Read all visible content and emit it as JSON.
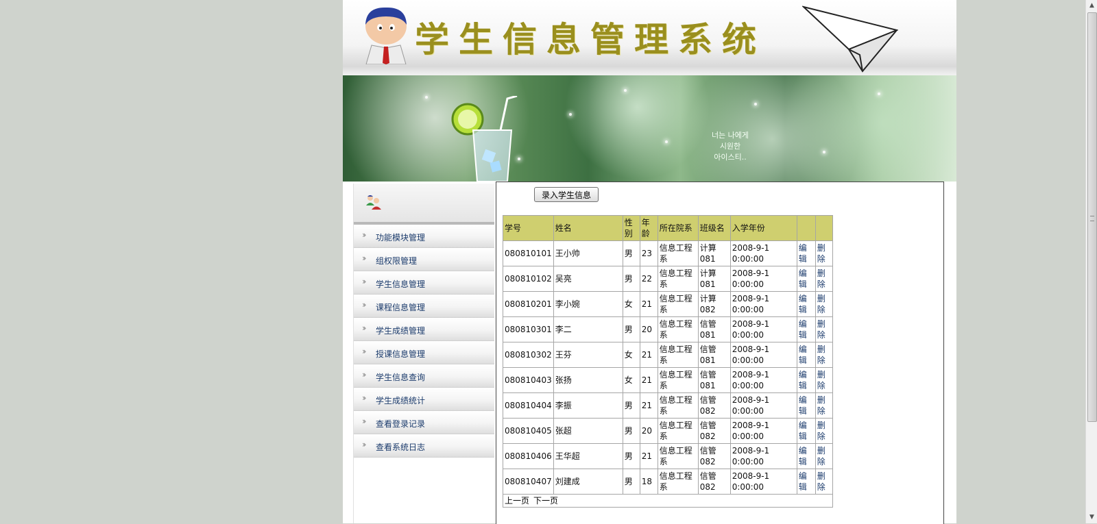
{
  "header": {
    "title": "学生信息管理系统"
  },
  "banner": {
    "caption_lines": [
      "너는 나에게",
      "시원한",
      "아이스티.."
    ]
  },
  "sidebar": {
    "items": [
      {
        "label": "功能模块管理"
      },
      {
        "label": "组权限管理"
      },
      {
        "label": "学生信息管理"
      },
      {
        "label": "课程信息管理"
      },
      {
        "label": "学生成绩管理"
      },
      {
        "label": "授课信息管理"
      },
      {
        "label": "学生信息查询"
      },
      {
        "label": "学生成绩统计"
      },
      {
        "label": "查看登录记录"
      },
      {
        "label": "查看系统日志"
      }
    ]
  },
  "main": {
    "add_button": "录入学生信息",
    "table": {
      "headers": [
        "学号",
        "姓名",
        "性别",
        "年龄",
        "所在院系",
        "班级名",
        "入学年份",
        "",
        ""
      ],
      "edit_label": "编辑",
      "delete_label": "删除",
      "rows": [
        [
          "080810101",
          "王小帅",
          "男",
          "23",
          "信息工程系",
          "计算081",
          "2008-9-1 0:00:00"
        ],
        [
          "080810102",
          "吴亮",
          "男",
          "22",
          "信息工程系",
          "计算081",
          "2008-9-1 0:00:00"
        ],
        [
          "080810201",
          "李小婉",
          "女",
          "21",
          "信息工程系",
          "计算082",
          "2008-9-1 0:00:00"
        ],
        [
          "080810301",
          "李二",
          "男",
          "20",
          "信息工程系",
          "信管081",
          "2008-9-1 0:00:00"
        ],
        [
          "080810302",
          "王芬",
          "女",
          "21",
          "信息工程系",
          "信管081",
          "2008-9-1 0:00:00"
        ],
        [
          "080810403",
          "张扬",
          "女",
          "21",
          "信息工程系",
          "信管081",
          "2008-9-1 0:00:00"
        ],
        [
          "080810404",
          "李振",
          "男",
          "21",
          "信息工程系",
          "信管082",
          "2008-9-1 0:00:00"
        ],
        [
          "080810405",
          "张超",
          "男",
          "20",
          "信息工程系",
          "信管082",
          "2008-9-1 0:00:00"
        ],
        [
          "080810406",
          "王华超",
          "男",
          "21",
          "信息工程系",
          "信管082",
          "2008-9-1 0:00:00"
        ],
        [
          "080810407",
          "刘建成",
          "男",
          "18",
          "信息工程系",
          "信管082",
          "2008-9-1 0:00:00"
        ]
      ]
    },
    "pager": {
      "prev": "上一页",
      "next": "下一页"
    }
  },
  "colors": {
    "header_title": "#9a8f1e",
    "table_header_bg": "#cfcf6f",
    "link": "#1a3a6b",
    "page_bg": "#cfd3cd"
  },
  "icons": [
    "user-avatar-icon",
    "paper-plane-icon",
    "users-icon",
    "chevron-double-right-icon"
  ]
}
